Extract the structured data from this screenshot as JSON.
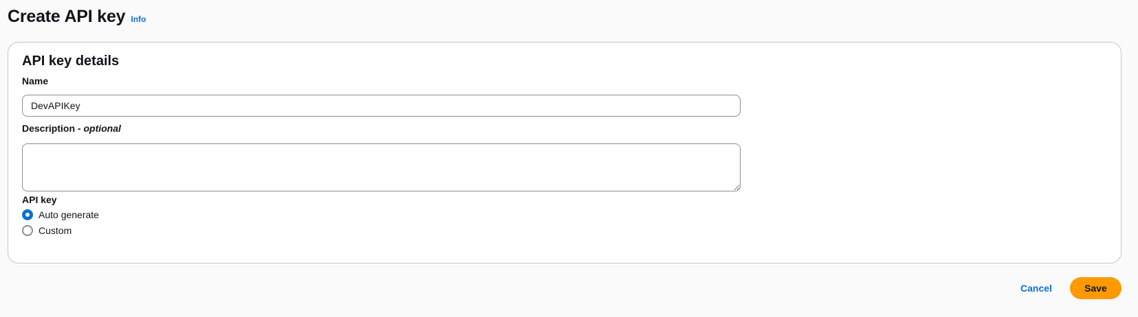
{
  "header": {
    "title": "Create API key",
    "info_label": "Info"
  },
  "panel": {
    "title": "API key details",
    "name": {
      "label": "Name",
      "value": "DevAPIKey"
    },
    "description": {
      "label": "Description - ",
      "optional_label": "optional",
      "value": ""
    },
    "api_key": {
      "label": "API key",
      "options": [
        {
          "label": "Auto generate",
          "selected": true
        },
        {
          "label": "Custom",
          "selected": false
        }
      ]
    }
  },
  "actions": {
    "cancel_label": "Cancel",
    "save_label": "Save"
  },
  "colors": {
    "accent": "#0972d3",
    "primary_button": "#ff9900",
    "background": "#fafafa"
  }
}
